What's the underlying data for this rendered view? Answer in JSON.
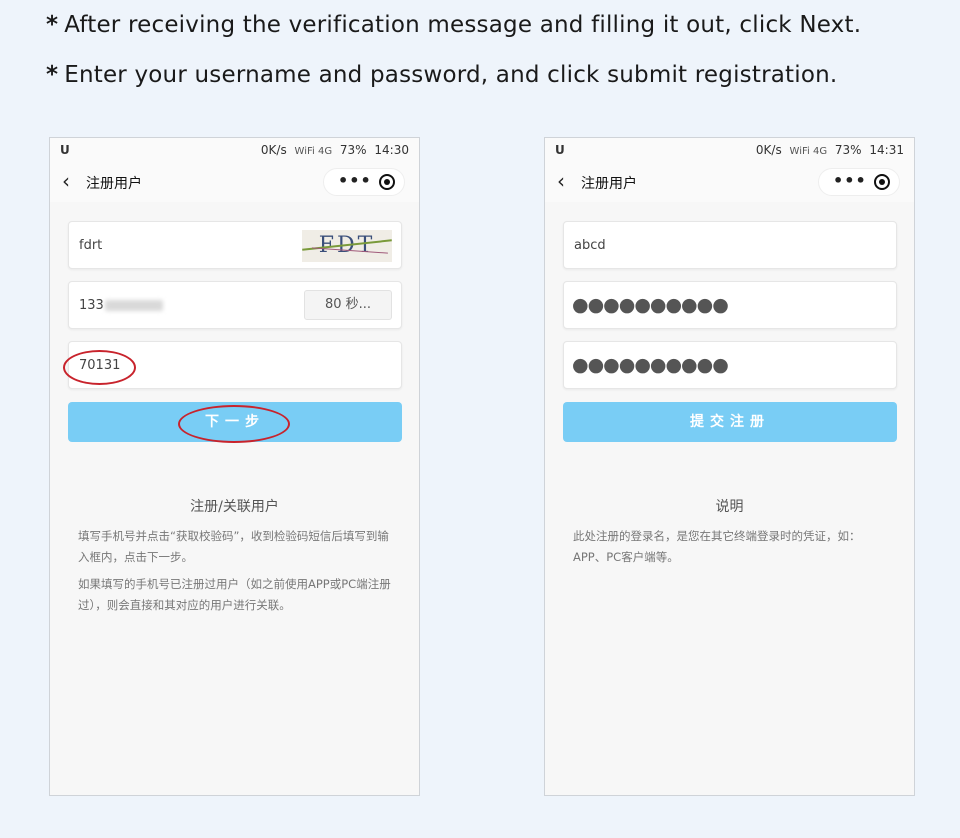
{
  "instructions": [
    {
      "star": "*",
      "text": "After receiving the verification message and filling it out, click Next."
    },
    {
      "star": "*",
      "text": "Enter your username and password, and click submit registration."
    }
  ],
  "left_phone": {
    "status": {
      "left_icon": "U",
      "speed": "0K/s",
      "signal": "WiFi 4G",
      "battery": "73%",
      "time": "14:30"
    },
    "nav": {
      "back": "‹",
      "title": "注册用户",
      "more": "•••"
    },
    "captcha_input": "fdrt",
    "captcha_image_text": "FDT",
    "phone_input_prefix": "133",
    "sms_button": "80 秒...",
    "code_input": "70131",
    "next_button": "下一步",
    "info": {
      "title": "注册/关联用户",
      "p1": "填写手机号并点击“获取校验码”，收到检验码短信后填写到输入框内，点击下一步。",
      "p2": "如果填写的手机号已注册过用户（如之前使用APP或PC端注册过），则会直接和其对应的用户进行关联。"
    },
    "highlight_color": "#c8232c"
  },
  "right_phone": {
    "status": {
      "left_icon": "U",
      "speed": "0K/s",
      "signal": "WiFi 4G",
      "battery": "73%",
      "time": "14:31"
    },
    "nav": {
      "back": "‹",
      "title": "注册用户",
      "more": "•••"
    },
    "username_input": "abcd",
    "password_dots": "●●●●●●●●●●",
    "confirm_password_dots": "●●●●●●●●●●",
    "submit_button": "提交注册",
    "info": {
      "title": "说明",
      "p1": "此处注册的登录名，是您在其它终端登录时的凭证，如：APP、PC客户端等。"
    }
  },
  "colors": {
    "primary_button": "#79cdf5",
    "background": "#eef4fb"
  }
}
